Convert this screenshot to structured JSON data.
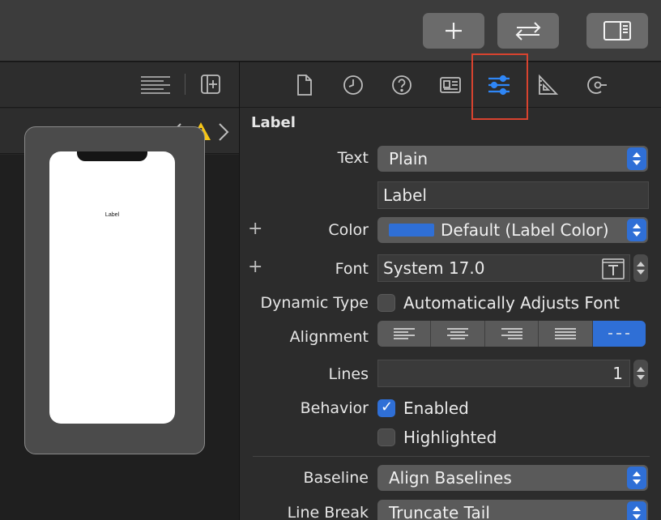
{
  "toolbar": {
    "buttons": [
      {
        "icon": "plus-icon"
      },
      {
        "icon": "swap-arrows-icon"
      },
      {
        "icon": "sidebar-toggle-icon"
      }
    ]
  },
  "inspector": {
    "tabs": [
      {
        "icon": "file-icon"
      },
      {
        "icon": "clock-icon"
      },
      {
        "icon": "help-icon"
      },
      {
        "icon": "identity-card-icon"
      },
      {
        "icon": "sliders-icon",
        "selected": true
      },
      {
        "icon": "ruler-icon"
      },
      {
        "icon": "connections-icon"
      }
    ],
    "section_title": "Label",
    "text": {
      "label": "Text",
      "value": "Plain",
      "field_value": "Label"
    },
    "color": {
      "label": "Color",
      "value": "Default (Label Color)",
      "swatch": "#2f6fd6"
    },
    "font": {
      "label": "Font",
      "value": "System 17.0"
    },
    "dynamic_type": {
      "label": "Dynamic Type",
      "checkbox_label": "Automatically Adjusts Font",
      "checked": false
    },
    "alignment": {
      "label": "Alignment",
      "options": [
        "left",
        "center",
        "right",
        "justified",
        "natural"
      ],
      "selected": "natural"
    },
    "lines": {
      "label": "Lines",
      "value": "1"
    },
    "behavior": {
      "label": "Behavior",
      "enabled_label": "Enabled",
      "enabled": true,
      "highlighted_label": "Highlighted",
      "highlighted": false
    },
    "baseline": {
      "label": "Baseline",
      "value": "Align Baselines"
    },
    "line_break": {
      "label": "Line Break",
      "value": "Truncate Tail"
    }
  },
  "canvas": {
    "preview_label": "Label"
  },
  "colors": {
    "accent": "#2f6fd6",
    "highlight_border": "#d9432f",
    "warning": "#f5c518"
  }
}
